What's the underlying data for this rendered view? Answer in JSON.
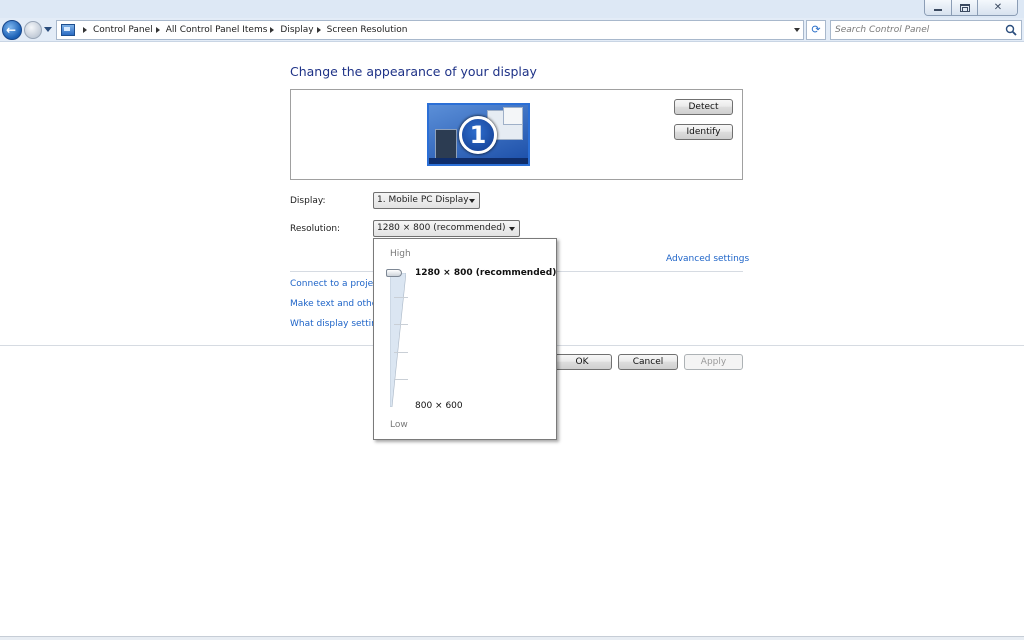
{
  "window": {
    "minimize_label": "",
    "maximize_label": "",
    "close_label": "✕"
  },
  "nav": {
    "breadcrumbs": [
      "Control Panel",
      "All Control Panel Items",
      "Display",
      "Screen Resolution"
    ],
    "search_placeholder": "Search Control Panel",
    "refresh_glyph": "⟳"
  },
  "page": {
    "heading": "Change the appearance of your display",
    "monitor_number": "1",
    "detect_label": "Detect",
    "identify_label": "Identify",
    "display_label": "Display:",
    "display_value": "1. Mobile PC Display",
    "resolution_label": "Resolution:",
    "resolution_value": "1280 × 800 (recommended)",
    "advanced_link": "Advanced settings",
    "links": [
      "Connect to a projector",
      "Make text and other items larger or smaller",
      "What display settings should I choose?"
    ],
    "ok_label": "OK",
    "cancel_label": "Cancel",
    "apply_label": "Apply"
  },
  "popup": {
    "high_label": "High",
    "low_label": "Low",
    "options": [
      "1280 × 800 (recommended)",
      "800 × 600"
    ],
    "selected_index": 0
  },
  "colors": {
    "heading": "#1e3287",
    "link": "#1e64c8",
    "monitor_border": "#2b6fd6"
  }
}
